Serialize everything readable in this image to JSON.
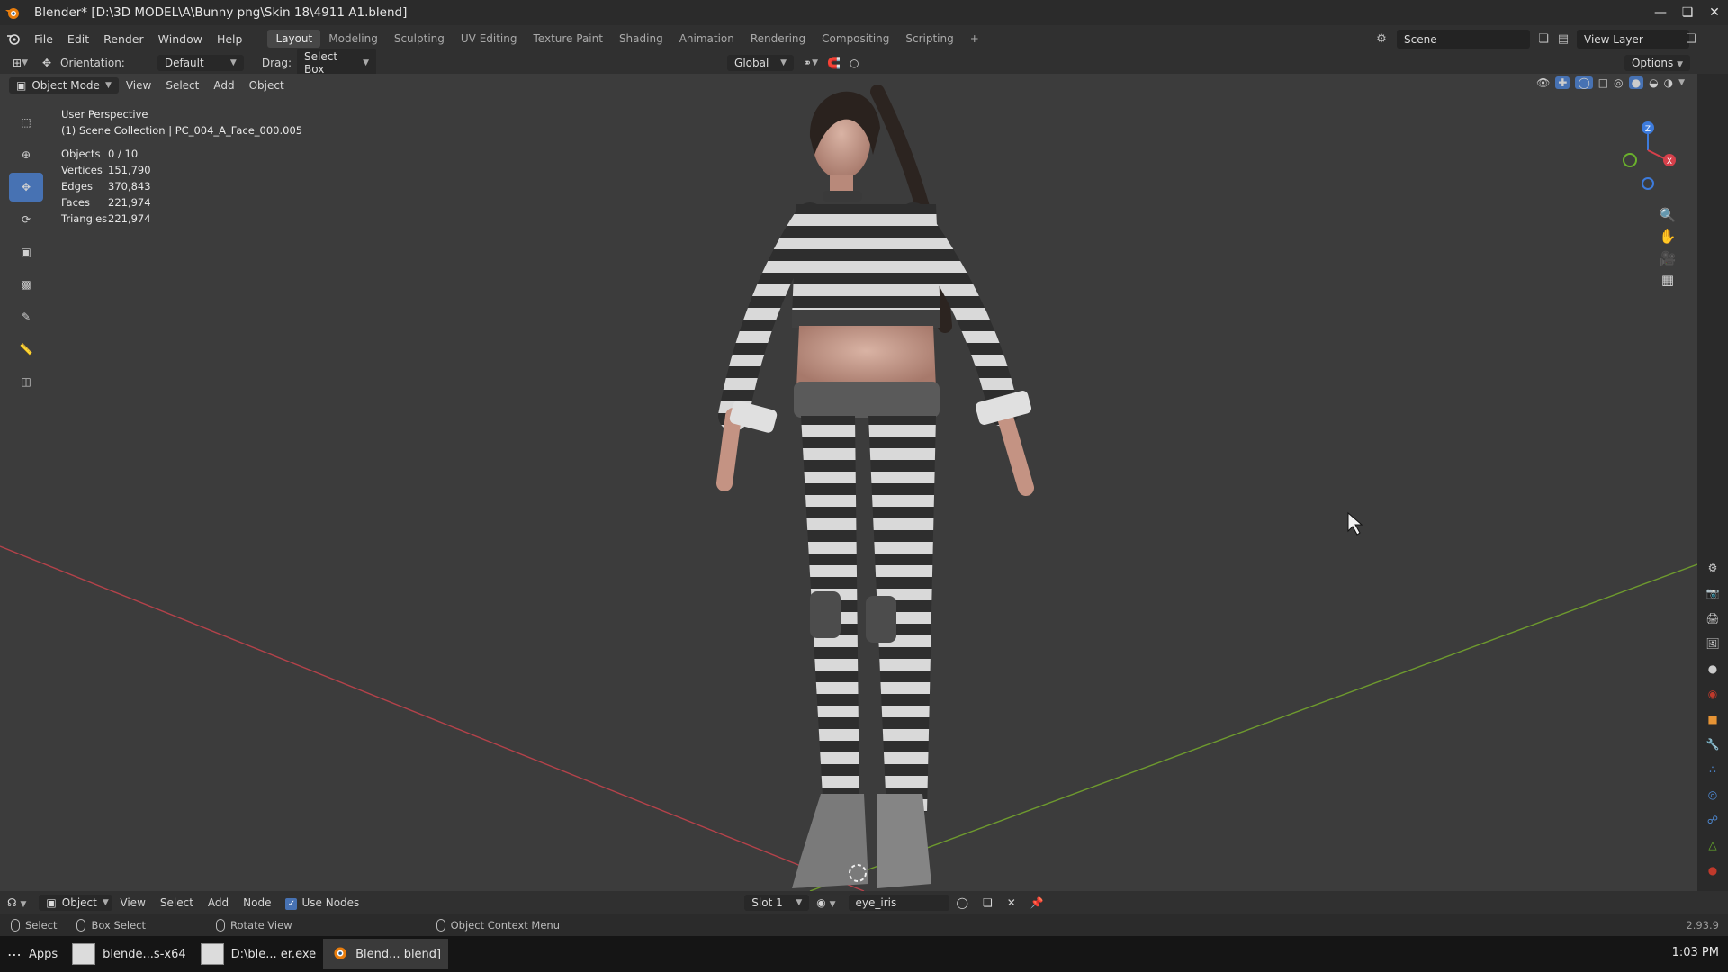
{
  "window": {
    "title": "Blender* [D:\\3D MODEL\\A\\Bunny png\\Skin 18\\4911 A1.blend]"
  },
  "menu": [
    "File",
    "Edit",
    "Render",
    "Window",
    "Help"
  ],
  "workspaces": [
    "Layout",
    "Modeling",
    "Sculpting",
    "UV Editing",
    "Texture Paint",
    "Shading",
    "Animation",
    "Rendering",
    "Compositing",
    "Scripting"
  ],
  "scene": {
    "name": "Scene",
    "view_layer": "View Layer"
  },
  "toolheader": {
    "orientation_label": "Orientation:",
    "orientation_value": "Default",
    "drag_label": "Drag:",
    "drag_value": "Select Box",
    "transform_orientation": "Global",
    "options": "Options"
  },
  "viewport_header": {
    "mode": "Object Mode",
    "items": [
      "View",
      "Select",
      "Add",
      "Object"
    ]
  },
  "overlay": {
    "perspective": "User Perspective",
    "collection": "(1) Scene Collection | PC_004_A_Face_000.005"
  },
  "stats": [
    {
      "label": "Objects",
      "value": "0 / 10"
    },
    {
      "label": "Vertices",
      "value": "151,790"
    },
    {
      "label": "Edges",
      "value": "370,843"
    },
    {
      "label": "Faces",
      "value": "221,974"
    },
    {
      "label": "Triangles",
      "value": "221,974"
    }
  ],
  "gizmo": {
    "z": "Z",
    "x": "X"
  },
  "node_editor": {
    "mode": "Object",
    "items": [
      "View",
      "Select",
      "Add",
      "Node"
    ],
    "use_nodes": "Use Nodes",
    "slot": "Slot 1",
    "material": "eye_iris"
  },
  "statusbar": {
    "select": "Select",
    "box_select": "Box Select",
    "rotate_view": "Rotate View",
    "context_menu": "Object Context Menu",
    "version": "2.93.9"
  },
  "taskbar": {
    "apps": "Apps",
    "items": [
      "blende...s-x64",
      "D:\\ble... er.exe",
      "Blend... blend]"
    ],
    "clock": "1:03 PM"
  },
  "colors": {
    "accent": "#4772b3",
    "viewport_bg": "#3c3c3c",
    "x_axis": "#b4424a",
    "y_axis": "#6e9a2e"
  }
}
